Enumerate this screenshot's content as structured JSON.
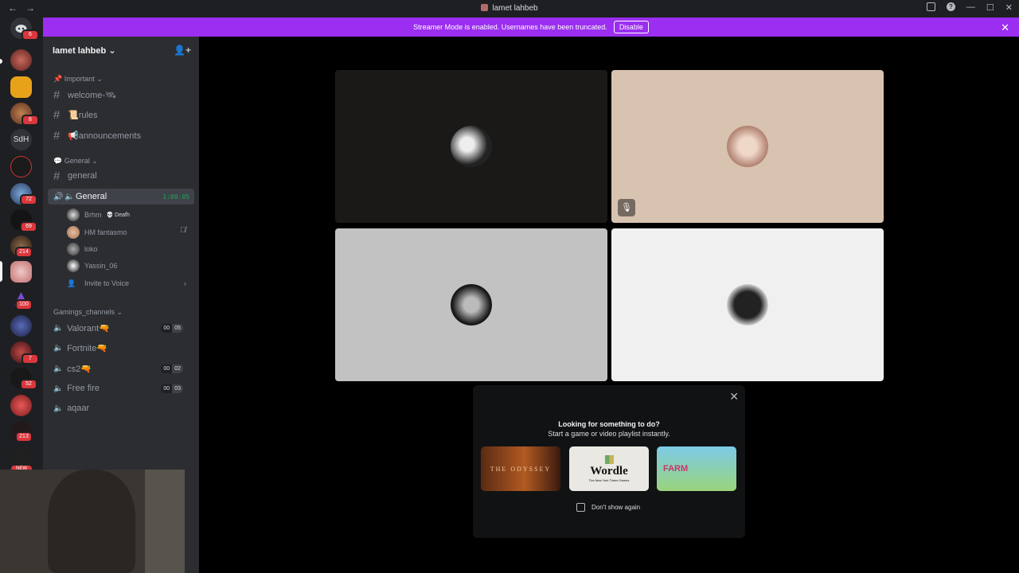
{
  "titlebar": {
    "title": "lamet lahbeb",
    "back": "←",
    "forward": "→",
    "minimize": "—",
    "maximize": "☐",
    "close": "✕"
  },
  "banner": {
    "text": "Streamer Mode is enabled. Usernames have been truncated.",
    "disable_label": "Disable",
    "close": "✕"
  },
  "guilds": {
    "home_badge": "6",
    "label_sdh": "SdH",
    "badges": [
      "8",
      "72",
      "69",
      "214",
      "100",
      "7",
      "52",
      "213"
    ],
    "new_label": "NEW"
  },
  "server": {
    "name": "lamet lahbeb",
    "chevron": "⌄",
    "add_member": "👤+"
  },
  "categories": {
    "important": "Important",
    "general": "General",
    "gaming": "Gamings_channels"
  },
  "text_channels": {
    "welcome": "welcome-🛰",
    "rules": "📜rules",
    "announcements": "📢announcements",
    "general": "general"
  },
  "voice_general": {
    "name": "General",
    "timer": "1:00:05"
  },
  "voice_users": [
    {
      "name": "Brhm",
      "tag": "💀 Deafh"
    },
    {
      "name": "HM fantasmo",
      "tag": ""
    },
    {
      "name": "loko",
      "tag": ""
    },
    {
      "name": "Yassin_06",
      "tag": ""
    }
  ],
  "invite": "Invite to Voice",
  "gaming_channels": [
    {
      "name": "Valorant🔫",
      "count_a": "00",
      "count_b": "05"
    },
    {
      "name": "Fortnite🔫",
      "count_a": "",
      "count_b": ""
    },
    {
      "name": "cs2🔫",
      "count_a": "00",
      "count_b": "02"
    },
    {
      "name": "Free fire",
      "count_a": "00",
      "count_b": "03"
    },
    {
      "name": "aqaar",
      "count_a": "",
      "count_b": ""
    }
  ],
  "activity": {
    "line1": "Looking for something to do?",
    "line2": "Start a game or video playlist instantly.",
    "card1": "THE ODYSSEY",
    "card2_title": "Wordle",
    "card2_sub": "The New York Times Games",
    "card3": "FARM",
    "dont_show": "Don't show again",
    "close": "✕"
  },
  "colors": {
    "accent": "#9b2ef0",
    "online": "#23a55a",
    "badge": "#da373c"
  }
}
